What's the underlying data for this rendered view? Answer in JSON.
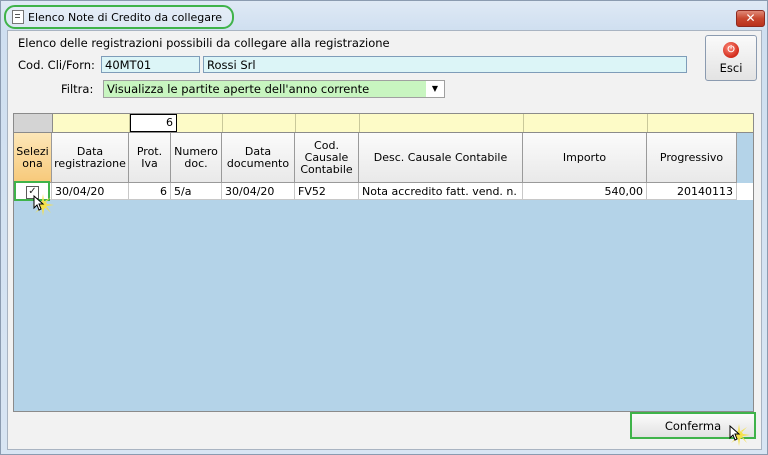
{
  "window": {
    "title": "Elenco Note di Credito da collegare",
    "close_label": "✕"
  },
  "header": {
    "description": "Elenco delle registrazioni possibili da collegare alla registrazione"
  },
  "filters": {
    "cod_label": "Cod. Cli/Forn:",
    "cod_value": "40MT01",
    "name_value": "Rossi Srl",
    "filtra_label": "Filtra:",
    "filtra_value": "Visualizza le partite aperte dell'anno corrente"
  },
  "buttons": {
    "esci_label": "Esci",
    "conferma_label": "Conferma"
  },
  "grid": {
    "count": "6",
    "columns": [
      "Selezi ona",
      "Data registrazione",
      "Prot. Iva",
      "Numero doc.",
      "Data documento",
      "Cod. Causale Contabile",
      "Desc. Causale Contabile",
      "Importo",
      "Progressivo"
    ],
    "rows": [
      {
        "selected": true,
        "data_registrazione": "30/04/20",
        "prot_iva": "6",
        "numero_doc": "5/a",
        "data_documento": "30/04/20",
        "cod_causale": "FV52",
        "desc_causale": "Nota accredito fatt. vend. n.",
        "importo": "540,00",
        "progressivo": "20140113"
      }
    ]
  },
  "colors": {
    "highlight": "#3fb34a",
    "grid_bg": "#b4d3e8",
    "field_bg": "#dcf5f7",
    "select_bg": "#c8f5c0"
  }
}
